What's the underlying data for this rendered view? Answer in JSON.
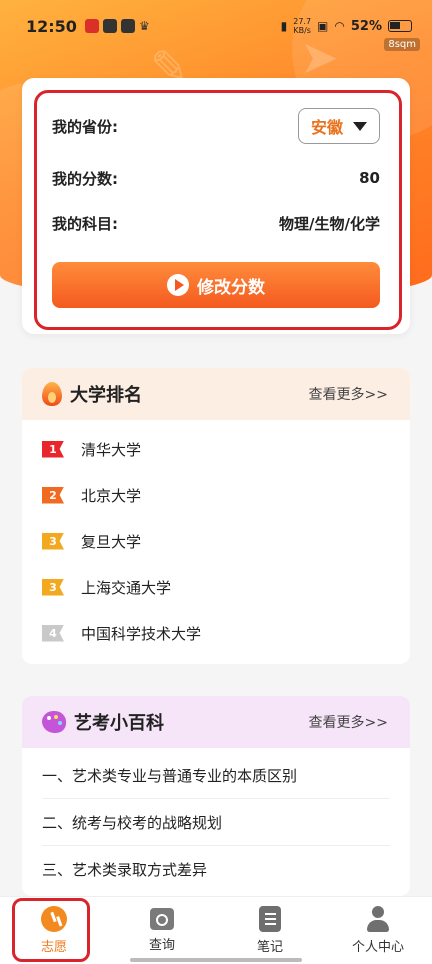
{
  "status_bar": {
    "time": "12:50",
    "speed_value": "27.7",
    "speed_unit": "KB/s",
    "battery": "52%",
    "overlay_tag": "8sqm"
  },
  "score_card": {
    "province_label": "我的省份:",
    "province_value": "安徽",
    "score_label": "我的分数:",
    "score_value": "80",
    "subjects_label": "我的科目:",
    "subjects_value": "物理/生物/化学",
    "modify_button": "修改分数"
  },
  "ranking": {
    "title": "大学排名",
    "more": "查看更多>>",
    "items": [
      {
        "rank": "1",
        "name": "清华大学",
        "color": "#e8262b"
      },
      {
        "rank": "2",
        "name": "北京大学",
        "color": "#f26a1f"
      },
      {
        "rank": "3",
        "name": "复旦大学",
        "color": "#f2a81f"
      },
      {
        "rank": "3",
        "name": "上海交通大学",
        "color": "#f2a81f"
      },
      {
        "rank": "4",
        "name": "中国科学技术大学",
        "color": "#c9c9c9"
      }
    ]
  },
  "art": {
    "title": "艺考小百科",
    "more": "查看更多>>",
    "items": [
      "一、艺术类专业与普通专业的本质区别",
      "二、统考与校考的战略规划",
      "三、艺术类录取方式差异"
    ]
  },
  "bottom_nav": {
    "items": [
      {
        "label": "志愿",
        "icon": "volunteer-icon",
        "active": true
      },
      {
        "label": "查询",
        "icon": "query-icon",
        "active": false
      },
      {
        "label": "笔记",
        "icon": "notes-icon",
        "active": false
      },
      {
        "label": "个人中心",
        "icon": "person-icon",
        "active": false
      }
    ]
  },
  "colors": {
    "accent": "#f07a1a",
    "highlight": "#d9242b",
    "ranking_header_bg": "#fdeee4",
    "art_header_bg": "#f6e4f8"
  }
}
